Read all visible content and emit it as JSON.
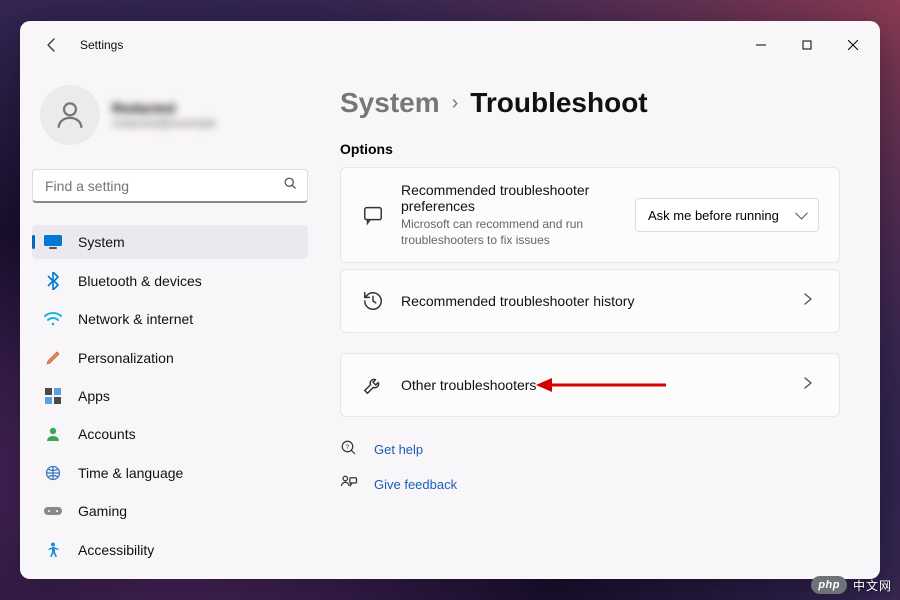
{
  "window": {
    "title": "Settings"
  },
  "profile": {
    "name": "Redacted",
    "email": "redacted@example"
  },
  "search": {
    "placeholder": "Find a setting"
  },
  "sidebar": {
    "items": [
      {
        "label": "System"
      },
      {
        "label": "Bluetooth & devices"
      },
      {
        "label": "Network & internet"
      },
      {
        "label": "Personalization"
      },
      {
        "label": "Apps"
      },
      {
        "label": "Accounts"
      },
      {
        "label": "Time & language"
      },
      {
        "label": "Gaming"
      },
      {
        "label": "Accessibility"
      }
    ]
  },
  "breadcrumb": {
    "parent": "System",
    "sep": "›",
    "current": "Troubleshoot"
  },
  "options": {
    "heading": "Options",
    "pref": {
      "title": "Recommended troubleshooter preferences",
      "subtitle": "Microsoft can recommend and run troubleshooters to fix issues",
      "dropdown_value": "Ask me before running"
    },
    "history": {
      "title": "Recommended troubleshooter history"
    },
    "other": {
      "title": "Other troubleshooters"
    }
  },
  "links": {
    "help": "Get help",
    "feedback": "Give feedback"
  },
  "watermark": {
    "badge": "php",
    "text": "中文网"
  }
}
